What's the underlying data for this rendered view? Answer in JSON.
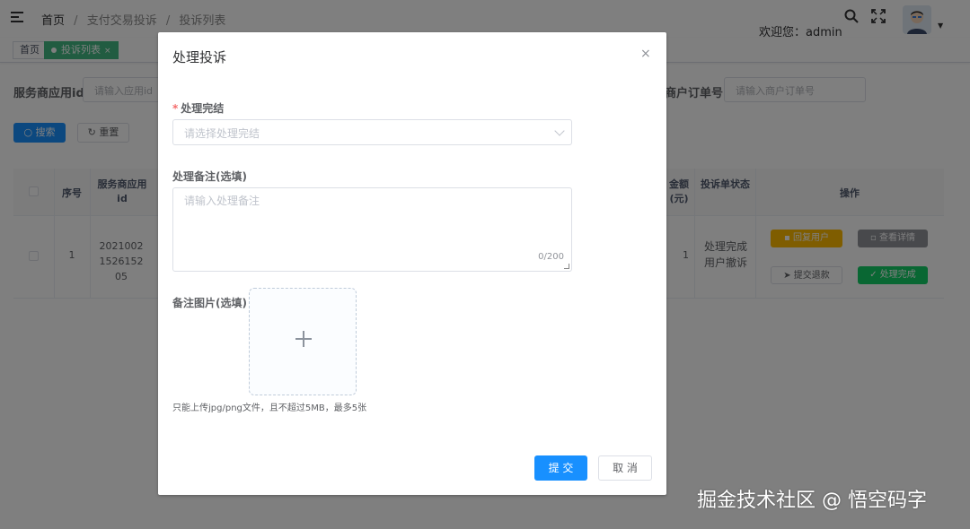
{
  "header": {
    "breadcrumb": [
      "首页",
      "支付交易投诉",
      "投诉列表"
    ],
    "welcome": "欢迎您：admin"
  },
  "tags": {
    "home": "首页",
    "active": "投诉列表",
    "close": "×"
  },
  "filter": {
    "service_label": "服务商应用id",
    "service_placeholder": "请输入应用id",
    "order_label": "商户订单号",
    "order_placeholder": "请输入商户订单号",
    "search_label": "搜索",
    "reset_label": "重置"
  },
  "table": {
    "headers": [
      "序号",
      "服务商应用id",
      "金额(元)",
      "投诉单状态",
      "操作"
    ],
    "rows": [
      {
        "index": "1",
        "app_id": "2021002152615205",
        "amount_partial": "1",
        "status": "处理完成用户撤诉"
      }
    ],
    "actions": [
      "回复用户",
      "查看详情",
      "提交退款",
      "处理完成"
    ]
  },
  "dialog": {
    "title": "处理投诉",
    "close": "×",
    "result_label": "处理完结",
    "result_placeholder": "请选择处理完结",
    "note_label": "处理备注(选填)",
    "note_placeholder": "请输入处理备注",
    "note_count": "0/200",
    "image_label": "备注图片(选填)",
    "upload_tip": "只能上传jpg/png文件，且不超过5MB，最多5张",
    "submit_label": "提 交",
    "cancel_label": "取 消"
  },
  "watermark": "掘金技术社区 @ 悟空码字",
  "colors": {
    "primary": "#1890ff",
    "warning": "#ffba00",
    "info": "#909399",
    "success": "#13ce66",
    "tag_active": "#42b983"
  }
}
